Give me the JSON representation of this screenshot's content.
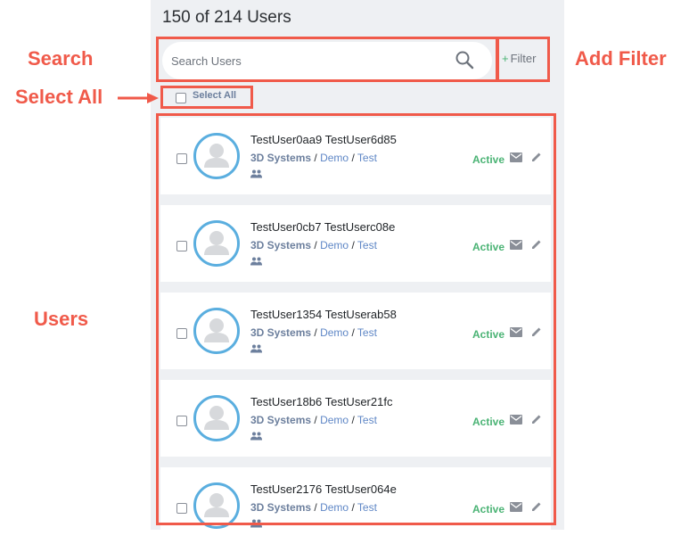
{
  "header": {
    "user_count": "150 of 214 Users"
  },
  "search": {
    "placeholder": "Search Users",
    "value": ""
  },
  "filter": {
    "plus": "+",
    "label": "Filter"
  },
  "select_all": {
    "label": "Select All",
    "checked": false
  },
  "users": [
    {
      "name": "TestUser0aa9 TestUser6d85",
      "org": "3D Systems",
      "sep1": "/",
      "group": "Demo",
      "sep2": "/",
      "team": "Test",
      "status": "Active",
      "checked": false
    },
    {
      "name": "TestUser0cb7 TestUserc08e",
      "org": "3D Systems",
      "sep1": "/",
      "group": "Demo",
      "sep2": "/",
      "team": "Test",
      "status": "Active",
      "checked": false
    },
    {
      "name": "TestUser1354 TestUserab58",
      "org": "3D Systems",
      "sep1": "/",
      "group": "Demo",
      "sep2": "/",
      "team": "Test",
      "status": "Active",
      "checked": false
    },
    {
      "name": "TestUser18b6 TestUser21fc",
      "org": "3D Systems",
      "sep1": "/",
      "group": "Demo",
      "sep2": "/",
      "team": "Test",
      "status": "Active",
      "checked": false
    },
    {
      "name": "TestUser2176 TestUser064e",
      "org": "3D Systems",
      "sep1": "/",
      "group": "Demo",
      "sep2": "/",
      "team": "Test",
      "status": "Active",
      "checked": false
    }
  ],
  "annotations": {
    "search": "Search",
    "add_filter": "Add Filter",
    "select_all": "Select All",
    "users": "Users"
  },
  "colors": {
    "annotation": "#f05a4a",
    "panel_bg": "#eef0f3",
    "avatar_ring": "#5aaedf",
    "status_active": "#4ab374",
    "org_text": "#6c7f9d",
    "link": "#5f87c6"
  },
  "icons": {
    "search": "search-icon",
    "avatar": "avatar-placeholder-icon",
    "group": "group-icon",
    "mail": "mail-icon",
    "edit": "edit-icon"
  }
}
